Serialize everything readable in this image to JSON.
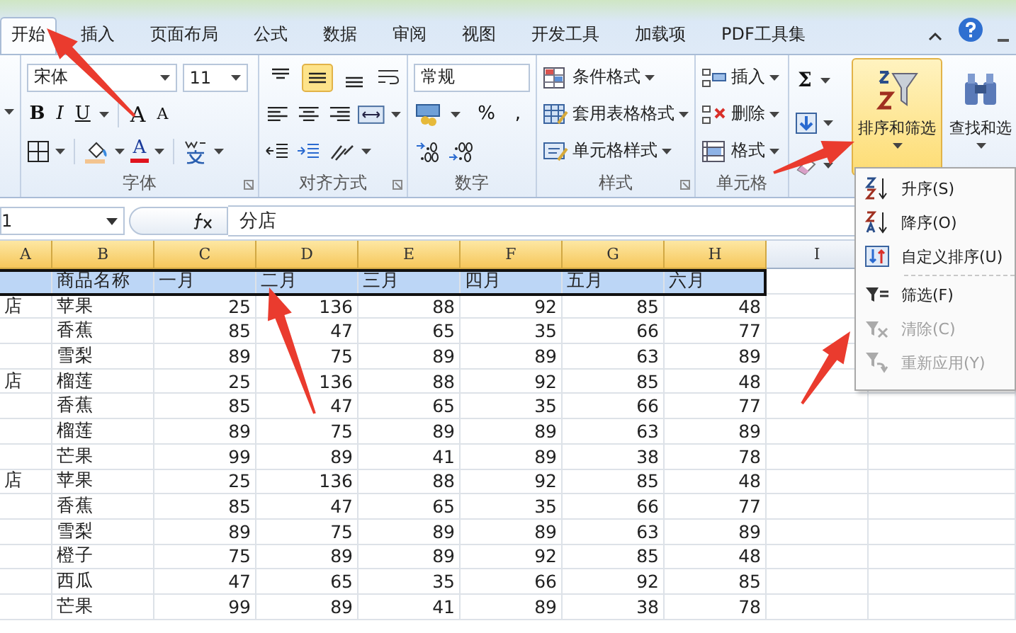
{
  "tabs": [
    {
      "label": "开始",
      "selected": true
    },
    {
      "label": "插入",
      "selected": false
    },
    {
      "label": "页面布局",
      "selected": false
    },
    {
      "label": "公式",
      "selected": false
    },
    {
      "label": "数据",
      "selected": false
    },
    {
      "label": "审阅",
      "selected": false
    },
    {
      "label": "视图",
      "selected": false
    },
    {
      "label": "开发工具",
      "selected": false
    },
    {
      "label": "加载项",
      "selected": false
    },
    {
      "label": "PDF工具集",
      "selected": false
    }
  ],
  "ribbon": {
    "font": {
      "name": "宋体",
      "size": "11",
      "style_buttons": [
        "B",
        "I",
        "U"
      ],
      "size_buttons": [
        "A",
        "A"
      ],
      "color_button": "A",
      "label": "字体"
    },
    "alignment": {
      "vertical": [
        {
          "selected": false
        },
        {
          "selected": true
        },
        {
          "selected": false
        }
      ],
      "label": "对齐方式"
    },
    "number": {
      "format": "常规",
      "symbols": [
        "%",
        ","
      ],
      "label": "数字"
    },
    "styles": {
      "items": [
        {
          "kind": "conditional",
          "label": "条件格式"
        },
        {
          "kind": "table",
          "label": "套用表格格式"
        },
        {
          "kind": "cell_style",
          "label": "单元格样式"
        }
      ],
      "label": "样式"
    },
    "cells": {
      "items": [
        {
          "kind": "insert",
          "label": "插入"
        },
        {
          "kind": "delete",
          "label": "删除"
        },
        {
          "kind": "format",
          "label": "格式"
        }
      ],
      "label": "单元格"
    },
    "editing": {
      "autosum": "Σ",
      "sort_filter": {
        "label": "排序和筛选",
        "selected": true
      },
      "find": {
        "label": "查找和选",
        "selected": false
      }
    }
  },
  "formula_bar": {
    "name_box": "1",
    "formula": "分店"
  },
  "columns": [
    {
      "label": "A",
      "selected": true
    },
    {
      "label": "B",
      "selected": true
    },
    {
      "label": "C",
      "selected": true
    },
    {
      "label": "D",
      "selected": true
    },
    {
      "label": "E",
      "selected": true
    },
    {
      "label": "F",
      "selected": true
    },
    {
      "label": "G",
      "selected": true
    },
    {
      "label": "H",
      "selected": true
    },
    {
      "label": "I",
      "selected": false
    }
  ],
  "rows": [
    {
      "kind": "header",
      "selected": true,
      "name": "商品名称",
      "values": [
        "一月",
        "二月",
        "三月",
        "四月",
        "五月",
        "六月"
      ]
    },
    {
      "kind": "data",
      "selected": false,
      "branch": "店",
      "name": "苹果",
      "values": [
        "25",
        "136",
        "88",
        "92",
        "85",
        "48"
      ]
    },
    {
      "kind": "data",
      "selected": false,
      "name": "香蕉",
      "values": [
        "85",
        "47",
        "65",
        "35",
        "66",
        "77"
      ]
    },
    {
      "kind": "data",
      "selected": false,
      "name": "雪梨",
      "values": [
        "89",
        "75",
        "89",
        "89",
        "63",
        "89"
      ]
    },
    {
      "kind": "data",
      "selected": false,
      "branch": "店",
      "name": "榴莲",
      "values": [
        "25",
        "136",
        "88",
        "92",
        "85",
        "48"
      ]
    },
    {
      "kind": "data",
      "selected": false,
      "name": "香蕉",
      "values": [
        "85",
        "47",
        "65",
        "35",
        "66",
        "77"
      ]
    },
    {
      "kind": "data",
      "selected": false,
      "name": "榴莲",
      "values": [
        "89",
        "75",
        "89",
        "89",
        "63",
        "89"
      ]
    },
    {
      "kind": "data",
      "selected": false,
      "name": "芒果",
      "values": [
        "99",
        "89",
        "41",
        "89",
        "38",
        "78"
      ]
    },
    {
      "kind": "data",
      "selected": false,
      "branch": "店",
      "name": "苹果",
      "values": [
        "25",
        "136",
        "88",
        "92",
        "85",
        "48"
      ]
    },
    {
      "kind": "data",
      "selected": false,
      "name": "香蕉",
      "values": [
        "85",
        "47",
        "65",
        "35",
        "66",
        "77"
      ]
    },
    {
      "kind": "data",
      "selected": false,
      "name": "雪梨",
      "values": [
        "89",
        "75",
        "89",
        "89",
        "63",
        "89"
      ]
    },
    {
      "kind": "data",
      "selected": false,
      "name": "橙子",
      "values": [
        "75",
        "89",
        "89",
        "92",
        "85",
        "48"
      ]
    },
    {
      "kind": "data",
      "selected": false,
      "name": "西瓜",
      "values": [
        "47",
        "65",
        "35",
        "66",
        "92",
        "85"
      ]
    },
    {
      "kind": "data",
      "selected": false,
      "name": "芒果",
      "values": [
        "99",
        "89",
        "41",
        "89",
        "38",
        "78"
      ]
    }
  ],
  "menu": {
    "items": [
      {
        "kind": "sort_asc",
        "label": "升序(S)",
        "disabled": false,
        "separator_before": false
      },
      {
        "kind": "sort_desc",
        "label": "降序(O)",
        "disabled": false,
        "separator_before": false
      },
      {
        "kind": "custom_sort",
        "label": "自定义排序(U)",
        "disabled": false,
        "separator_before": false
      },
      {
        "kind": "filter",
        "label": "筛选(F)",
        "disabled": false,
        "separator_before": true
      },
      {
        "kind": "clear",
        "label": "清除(C)",
        "disabled": true,
        "separator_before": false
      },
      {
        "kind": "reapply",
        "label": "重新应用(Y)",
        "disabled": true,
        "separator_before": false
      }
    ]
  }
}
